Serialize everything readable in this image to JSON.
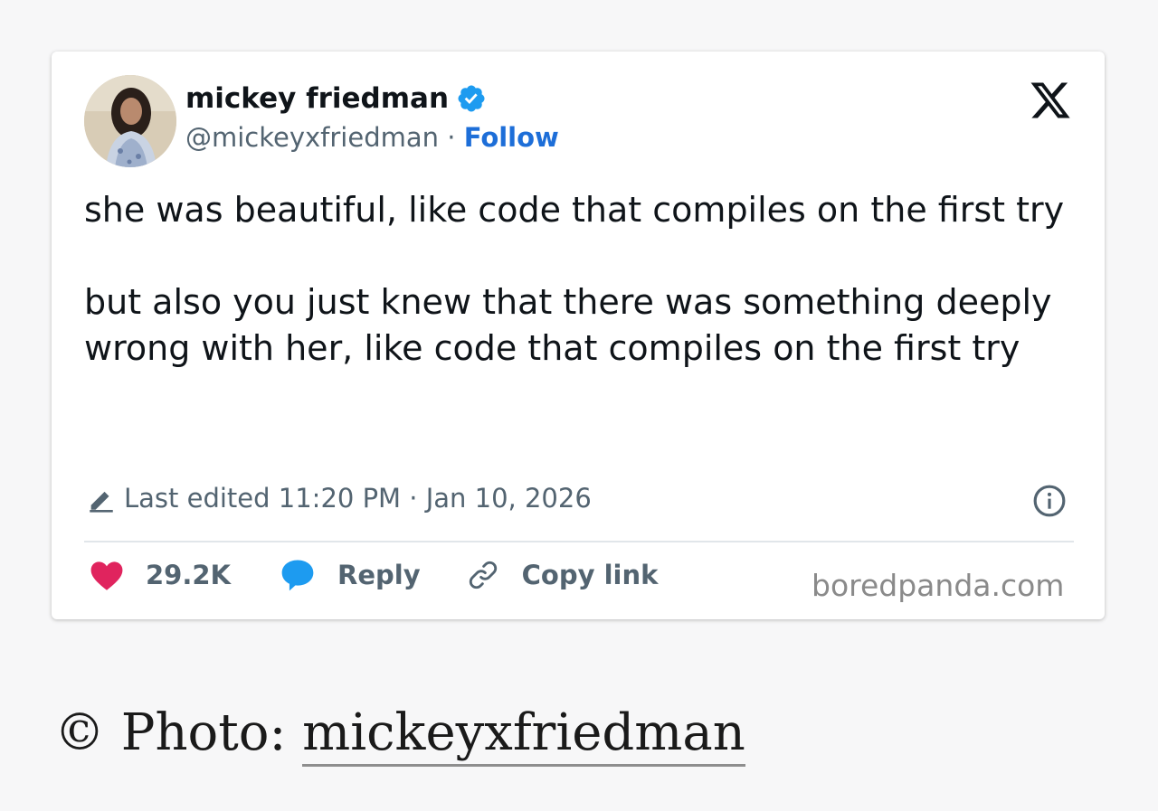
{
  "tweet": {
    "author": {
      "name": "mickey friedman",
      "handle": "@mickeyxfriedman",
      "separator": "·",
      "follow_label": "Follow"
    },
    "paragraphs": [
      "she was beautiful, like code that compiles on the first try",
      "but also you just knew that there was something deeply wrong with her, like code that compiles on the first try"
    ],
    "edited": {
      "text": "Last edited 11:20 PM · Jan 10, 2026"
    },
    "actions": {
      "likes": "29.2K",
      "reply_label": "Reply",
      "copy_link_label": "Copy link"
    },
    "watermark": "boredpanda.com"
  },
  "credit": {
    "prefix": "© Photo: ",
    "link_text": "mickeyxfriedman"
  },
  "colors": {
    "link_blue": "#1d6ed8",
    "verified_blue": "#1d9bf0",
    "like_pink": "#e0245e",
    "reply_blue": "#1d9bf0",
    "muted_gray": "#536471"
  },
  "icons": [
    "verified-badge-icon",
    "x-logo-icon",
    "pencil-icon",
    "info-icon",
    "heart-icon",
    "speech-bubble-icon",
    "link-icon"
  ]
}
